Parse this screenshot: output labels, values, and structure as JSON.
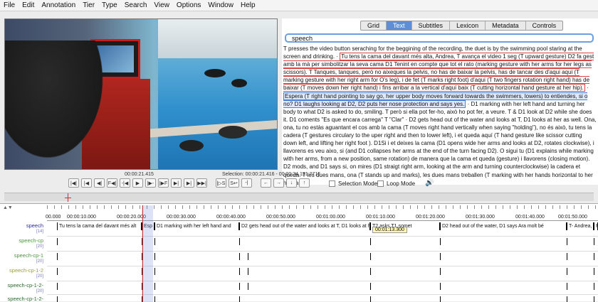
{
  "menu": [
    "File",
    "Edit",
    "Annotation",
    "Tier",
    "Type",
    "Search",
    "View",
    "Options",
    "Window",
    "Help"
  ],
  "tabs": [
    "Grid",
    "Text",
    "Subtitles",
    "Lexicon",
    "Metadata",
    "Controls"
  ],
  "active_tab": "Text",
  "tier_selected": "speech",
  "transcript": {
    "pre": "T presses the video button seraching for the beggining of the recording, the duet is by the swimming pool staring at the screen and drinking. · ",
    "h1": "Tu tens la cama del davant més alta, Andrea, T avança el video 1 seg (T upward gesture)  D2 fa gest amb la mà per simbolitzar la seva cama D1 Tenint en compte que tot el rato (marking gesture with her arms for her legs as scissors). T  Tanques, tanques, però no aixeques la pelvis, no has de baixar la pelvis, has de tancar des d'aqui aqui (T marking gesture with her right arm for O's leg), i de fet (T marks right foot) d'aqui (T two fingers rotation right hand)  has de baixar (T moves down her right hand) i fins arribar a la vertical d'aquí baix (T cutting horizontal hand gesture at her hip).",
    "mid": " · ",
    "h2": "Espera (T right hand pointing to say go, her upper body moves forward towards the swimmers, lowers) to entiendes, si o no? D1 laughs looking at D2, D2 puts her nose protection and says yes.",
    "post": " · D1 marking with her left hand and turning her body to what D2 is asked to do, smiling. T però si ella pot fer-ho, això ho pot fer, a veure. T & D1 look at D2 while she does it. D1 coments \"Es que encara carrega\" T \"Clar\" · D2 gets head out of the water and looks at T, D1 looks at her as well. Ona, ona, tu no estàs aguantant el cos amb la cama (T moves right hand vertically when saying \"holding\"), no és això, tu tens la cadera (T gestures circulary to the uper right and then to lower left), i et queda aquí (T hand gesture like scissor cutting down left, and lifting her right foot ). D1Si i et deixes la cama (D1 opens wide her arms and looks at D2, rotates clockwise), i llavorens es veu aixo, si (and D1 collapses her arms at the end of the turn facing D2). O sigui tu (D1 explains while marking with her arms, from a new position, same rotation) de manera que la cama et queda (gesture) i llavorens (closing motion). D2 mods, and D1 says si, on mires (D1 straigt right arm, looking at the arm and turning counterclockwise) la cadera et queda. T les dues mans, ona (T stands up and marks), les dues mans treballen (T marking with her hands horizontal to her hips and"
  },
  "time_display": "00:00:21.415",
  "selection_display": "Selection: 00:00:21.416 - 00:00:24.131  2715",
  "controls": [
    "|◀|",
    "|◀",
    "◀|",
    "F◀|",
    "-|◀",
    "▶",
    "|▶-",
    "|▶F",
    "▶|",
    "▶|",
    "▶▶|"
  ],
  "controls2": [
    "|▷S",
    "S↩",
    "-|"
  ],
  "controls3": [
    "←",
    "→",
    "↓",
    "↑"
  ],
  "selection_mode": "Selection Mode",
  "loop_mode": "Loop Mode",
  "ruler_ticks": [
    "00:00:10.000",
    "00:00:20.000",
    "00:00:30.000",
    "00:00:40.000",
    "00:00:50.000",
    "00:01:00.000",
    "00:01:10.000",
    "00:01:20.000",
    "00:01:30.000",
    "00:01:40.000",
    "00:01:50.000",
    "00:02:00.000"
  ],
  "ruler_start": "00.000",
  "hover_time": "00:01:13.300",
  "tiers": [
    {
      "name": "speech",
      "count": "[14]",
      "color": "#2b2b99"
    },
    {
      "name": "speech-cp",
      "count": "[20]",
      "color": "#4a9a3a"
    },
    {
      "name": "speech-cp-1",
      "count": "[20]",
      "color": "#4a9a3a"
    },
    {
      "name": "speech-cp-1-2",
      "count": "[20]",
      "color": "#9aa03a"
    },
    {
      "name": "speech-cp-1-2-",
      "count": "[20]",
      "color": "#2b6a2b"
    },
    {
      "name": "speech-cp-1-2-",
      "count": "",
      "color": "#2b6a2b"
    }
  ],
  "speech_annotations": [
    "Tu tens la cama del davant més alt",
    "Esp",
    "D1 marking with her left hand and",
    "D2 gets head out of the water and looks at T, D1 looks at her as",
    "T2 asks T1 somet",
    "D2 head out of the water, D1 says Ara molt bé",
    "T- Andrea,",
    "Perq"
  ]
}
